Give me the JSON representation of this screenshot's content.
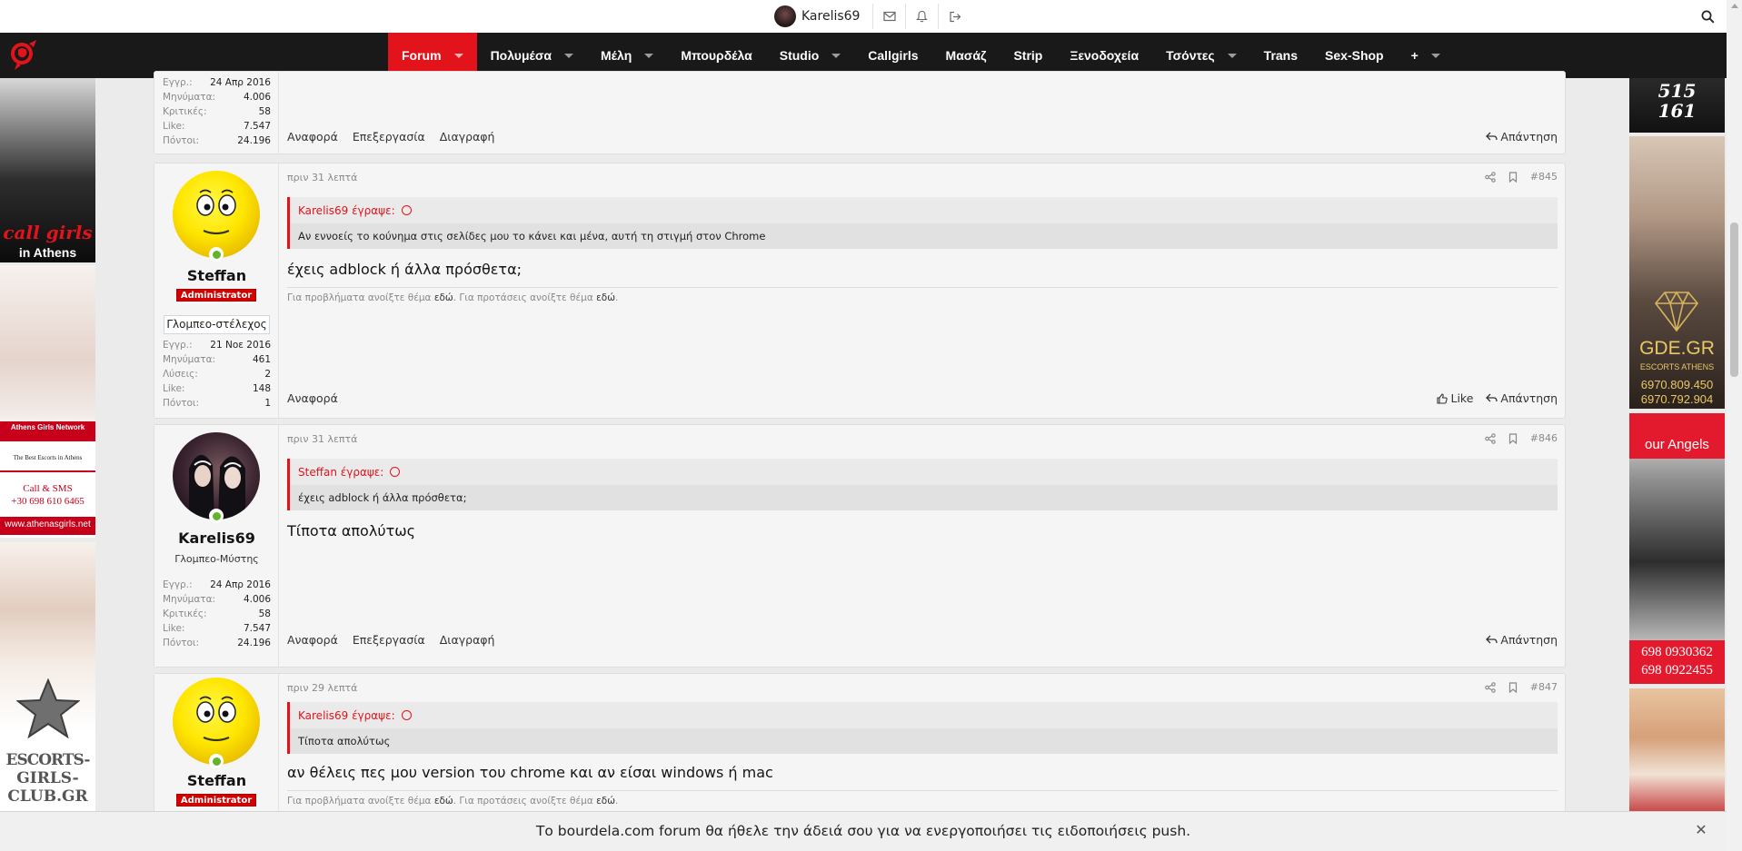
{
  "userbar": {
    "username": "Karelis69",
    "icons": [
      "envelope-icon",
      "bell-icon",
      "logout-icon",
      "search-icon"
    ]
  },
  "nav": {
    "items": [
      {
        "label": "Forum",
        "caret": true,
        "active": true
      },
      {
        "label": "Πολυμέσα",
        "caret": true
      },
      {
        "label": "Μέλη",
        "caret": true
      },
      {
        "label": "Μπουρδέλα",
        "caret": false
      },
      {
        "label": "Studio",
        "caret": true
      },
      {
        "label": "Callgirls",
        "caret": false
      },
      {
        "label": "Μασάζ",
        "caret": false
      },
      {
        "label": "Strip",
        "caret": false
      },
      {
        "label": "Ξενοδοχεία",
        "caret": false
      },
      {
        "label": "Τσόντες",
        "caret": true
      },
      {
        "label": "Trans",
        "caret": false
      },
      {
        "label": "Sex-Shop",
        "caret": false
      },
      {
        "label": "+",
        "caret": true
      }
    ]
  },
  "ads": {
    "left1": {
      "line1": "call girls",
      "line2": "in Athens"
    },
    "left2": {
      "brand": "Athens Girls Network",
      "tagline": "The Best Escorts in Athens",
      "call": "Call & SMS",
      "phone": "+30 698 610 6465",
      "site": "www.athenasgirls.net"
    },
    "left3": {
      "line1": "ESCORTS-",
      "line2": "GIRLS-",
      "line3": "CLUB.GR"
    },
    "right1": {
      "line1": "515",
      "line2": "161"
    },
    "right2": {
      "brand": "GDE.GR",
      "sub": "ESCORTS ATHENS",
      "phone1": "6970.809.450",
      "phone2": "6970.792.904"
    },
    "right3": {
      "brand": "our Angels",
      "phone1": "698 0930362",
      "phone2": "698 0922455"
    }
  },
  "post0": {
    "stats": [
      {
        "k": "Εγγρ.:",
        "v": "24 Απρ 2016"
      },
      {
        "k": "Μηνύματα:",
        "v": "4.006"
      },
      {
        "k": "Κριτικές:",
        "v": "58"
      },
      {
        "k": "Like:",
        "v": "7.547"
      },
      {
        "k": "Πόντοι:",
        "v": "24.196"
      }
    ],
    "actions_left": [
      "Αναφορά",
      "Επεξεργασία",
      "Διαγραφή"
    ],
    "reply": "Απάντηση"
  },
  "post1": {
    "username": "Steffan",
    "badge": "Administrator",
    "user_title": "Γλομπεο-στέλεχος",
    "stats": [
      {
        "k": "Εγγρ.:",
        "v": "21 Νοε 2016"
      },
      {
        "k": "Μηνύματα:",
        "v": "461"
      },
      {
        "k": "Λύσεις:",
        "v": "2"
      },
      {
        "k": "Like:",
        "v": "148"
      },
      {
        "k": "Πόντοι:",
        "v": "1"
      }
    ],
    "date": "πριν 31 λεπτά",
    "number": "#845",
    "quote_author": "Karelis69 έγραψε:",
    "quote_text": "Αν εννοείς το κούνημα στις σελίδες μου το κάνει και μένα, αυτή τη στιγμή στον Chrome",
    "message": "έχεις adblock ή άλλα πρόσθετα;",
    "sig_a": "Για προβλήματα ανοίξτε θέμα ",
    "sig_link1": "εδώ",
    "sig_b": ". Για προτάσεις ανοίξτε θέμα ",
    "sig_link2": "εδώ",
    "sig_c": ".",
    "actions_left": [
      "Αναφορά"
    ],
    "like": "Like",
    "reply": "Απάντηση"
  },
  "post2": {
    "username": "Karelis69",
    "user_title": "Γλομπεο-Μύστης",
    "stats": [
      {
        "k": "Εγγρ.:",
        "v": "24 Απρ 2016"
      },
      {
        "k": "Μηνύματα:",
        "v": "4.006"
      },
      {
        "k": "Κριτικές:",
        "v": "58"
      },
      {
        "k": "Like:",
        "v": "7.547"
      },
      {
        "k": "Πόντοι:",
        "v": "24.196"
      }
    ],
    "date": "πριν 31 λεπτά",
    "number": "#846",
    "quote_author": "Steffan έγραψε:",
    "quote_text": "έχεις adblock ή άλλα πρόσθετα;",
    "message": "Τίποτα απολύτως",
    "actions_left": [
      "Αναφορά",
      "Επεξεργασία",
      "Διαγραφή"
    ],
    "reply": "Απάντηση"
  },
  "post3": {
    "username": "Steffan",
    "badge": "Administrator",
    "date": "πριν 29 λεπτά",
    "number": "#847",
    "quote_author": "Karelis69 έγραψε:",
    "quote_text": "Τίποτα απολύτως",
    "message": "αν θέλεις πες μου version του chrome και αν είσαι windows ή mac",
    "sig_a": "Για προβλήματα ανοίξτε θέμα ",
    "sig_link1": "εδώ",
    "sig_b": ". Για προτάσεις ανοίξτε θέμα ",
    "sig_link2": "εδώ",
    "sig_c": "."
  },
  "push": {
    "text": "Το bourdela.com forum θα ήθελε την άδειά σου για να ενεργοποιήσει τις ειδοποιήσεις push.",
    "close": "✕"
  },
  "colors": {
    "accent": "#e3131c",
    "nav_bg": "#191919",
    "page_bg": "#ebebeb",
    "online": "#63b42a"
  }
}
